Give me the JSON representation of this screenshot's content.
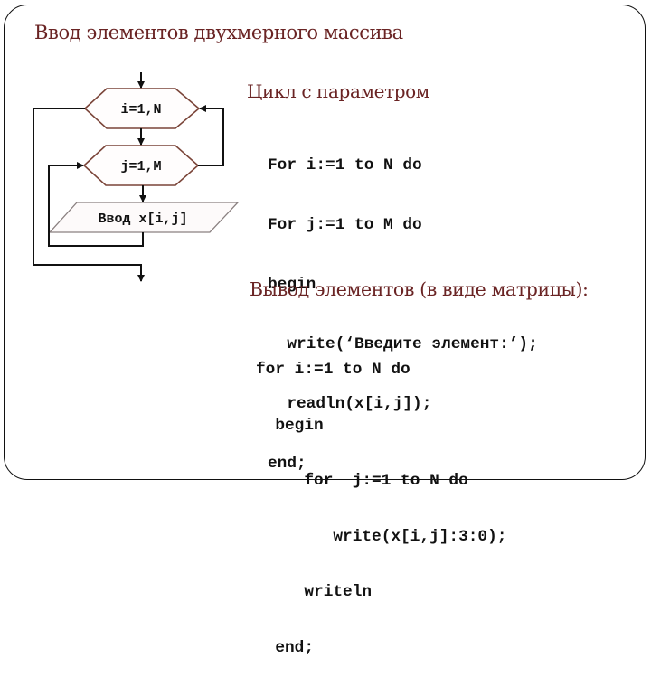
{
  "slide": {
    "title": "Ввод элементов двухмерного массива",
    "title_color": "#6a2424"
  },
  "flowchart": {
    "outer_loop_label": "i=1,N",
    "inner_loop_label": "j=1,M",
    "input_label": "Ввод x[i,j]",
    "decision_stroke": "#7a4438",
    "io_stroke": "#8a8080"
  },
  "section_loop": {
    "heading": "Цикл с параметром",
    "code_lines": [
      "For i:=1 to N do",
      "For j:=1 to M do",
      "begin",
      "  write(‘Введите элемент:’);",
      "  readln(x[i,j]);",
      "end;"
    ]
  },
  "section_output": {
    "heading": "Вывод элементов (в виде матрицы):",
    "code_lines": [
      "for i:=1 to N do",
      "  begin",
      "     for  j:=1 to N do",
      "        write(x[i,j]:3:0);",
      "     writeln",
      "  end;"
    ]
  }
}
